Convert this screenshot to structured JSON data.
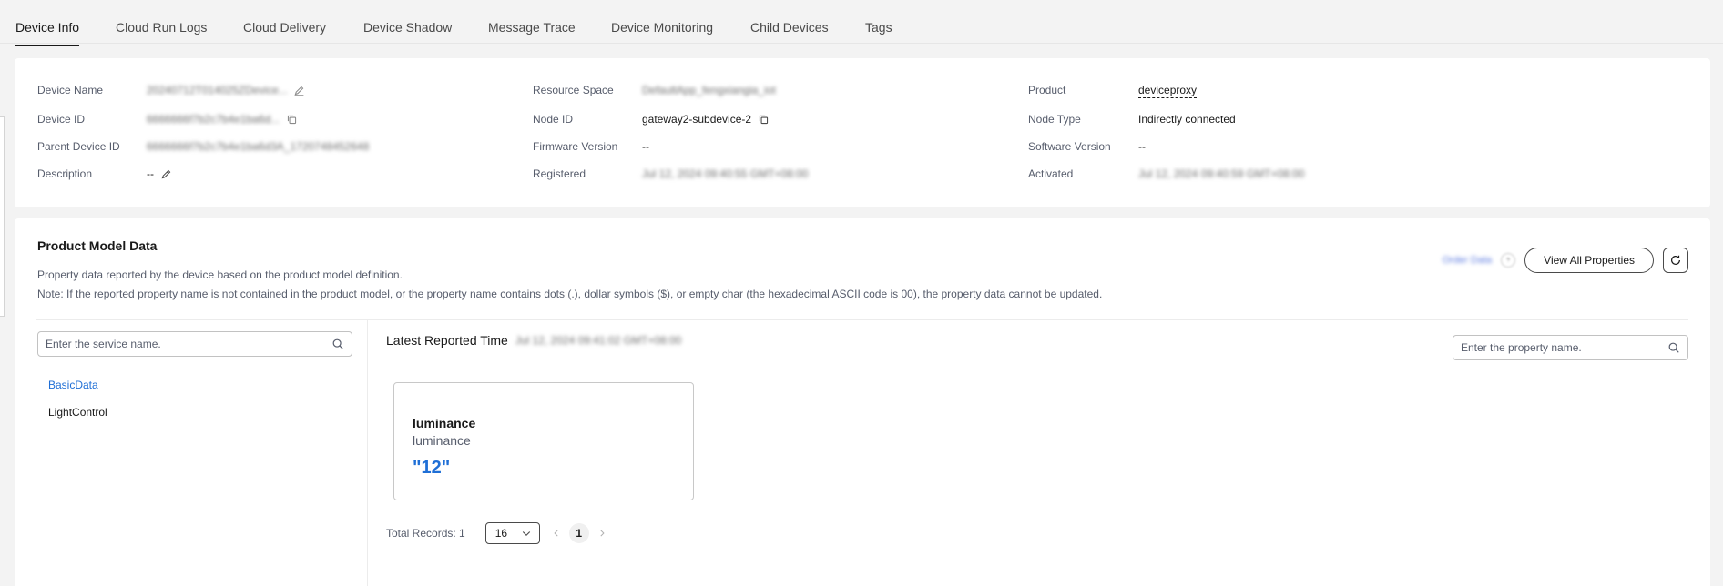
{
  "tabs": [
    {
      "label": "Device Info",
      "active": true
    },
    {
      "label": "Cloud Run Logs"
    },
    {
      "label": "Cloud Delivery"
    },
    {
      "label": "Device Shadow"
    },
    {
      "label": "Message Trace"
    },
    {
      "label": "Device Monitoring"
    },
    {
      "label": "Child Devices"
    },
    {
      "label": "Tags"
    }
  ],
  "device_info": {
    "device_name": {
      "label": "Device Name",
      "value": "20240712T014025ZDevice..."
    },
    "device_id": {
      "label": "Device ID",
      "value": "6666666f7b2c7b4e1ba6d..."
    },
    "parent_device_id": {
      "label": "Parent Device ID",
      "value": "6666666f7b2c7b4e1ba6d3A_1720748452648"
    },
    "description": {
      "label": "Description",
      "value": "--"
    },
    "resource_space": {
      "label": "Resource Space",
      "value": "DefaultApp_fengxiangia_iot"
    },
    "node_id": {
      "label": "Node ID",
      "value": "gateway2-subdevice-2"
    },
    "firmware_version": {
      "label": "Firmware Version",
      "value": "--"
    },
    "registered": {
      "label": "Registered",
      "value": "Jul 12, 2024 09:40:55 GMT+08:00"
    },
    "product": {
      "label": "Product",
      "value": "deviceproxy"
    },
    "node_type": {
      "label": "Node Type",
      "value": "Indirectly connected"
    },
    "software_version": {
      "label": "Software Version",
      "value": "--"
    },
    "activated": {
      "label": "Activated",
      "value": "Jul 12, 2024 09:40:59 GMT+08:00"
    }
  },
  "model": {
    "title": "Product Model Data",
    "desc1": "Property data reported by the device based on the product model definition.",
    "desc2": "Note: If the reported property name is not contained in the product model, or the property name contains dots (.), dollar symbols ($), or empty char (the hexadecimal ASCII code is 00), the property data cannot be updated.",
    "order_link": "Order Data",
    "view_all": "View All Properties",
    "service_search_placeholder": "Enter the service name.",
    "property_search_placeholder": "Enter the property name.",
    "services": [
      {
        "label": "BasicData",
        "active": true
      },
      {
        "label": "LightControl"
      }
    ],
    "latest_label": "Latest Reported Time",
    "latest_time": "Jul 12, 2024 09:41:02 GMT+08:00",
    "property": {
      "name": "luminance",
      "sub": "luminance",
      "value": "\"12\""
    },
    "total_records": "Total Records: 1",
    "page_size": "16",
    "current_page": "1"
  },
  "colors": {
    "accent": "#1f6fd6",
    "text": "#191919",
    "muted": "#575d6c"
  }
}
